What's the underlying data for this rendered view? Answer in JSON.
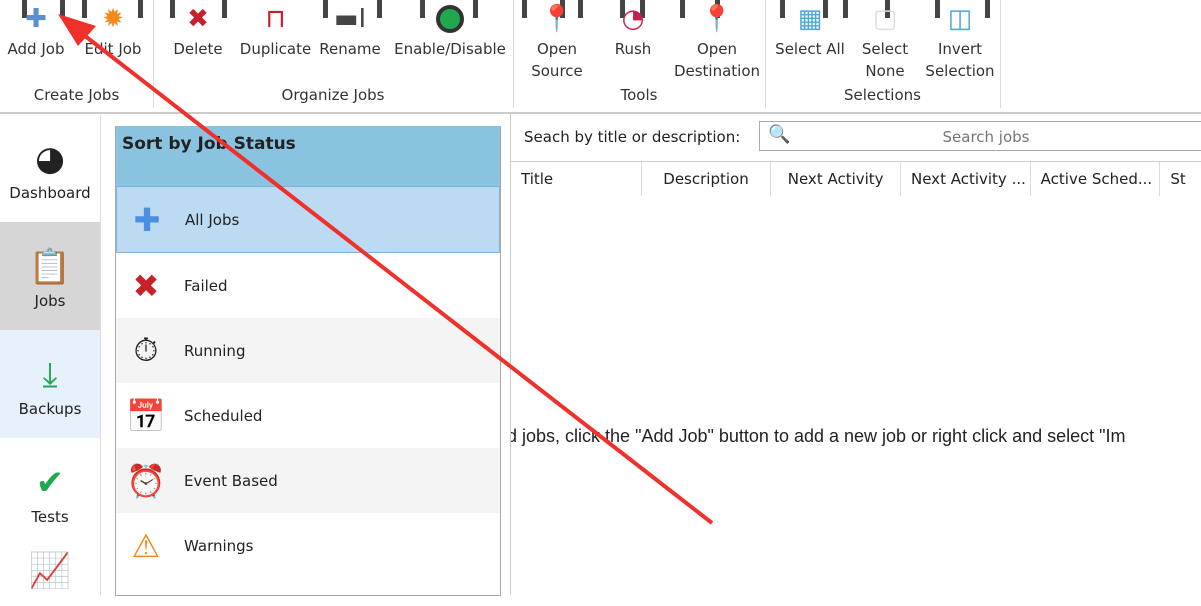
{
  "ribbon": {
    "groups": [
      {
        "label": "Create Jobs"
      },
      {
        "label": "Organize Jobs"
      },
      {
        "label": "Tools"
      },
      {
        "label": "Selections"
      }
    ],
    "buttons": {
      "add_job": "Add Job",
      "edit_job": "Edit Job",
      "delete": "Delete",
      "duplicate": "Duplicate",
      "rename": "Rename",
      "enable_disable": "Enable/Disable",
      "open_source": [
        "Open",
        "Source"
      ],
      "rush": "Rush",
      "open_destination": [
        "Open",
        "Destination"
      ],
      "select_all": "Select All",
      "select_none": [
        "Select",
        "None"
      ],
      "invert_selection": [
        "Invert",
        "Selection"
      ]
    }
  },
  "nav": [
    {
      "label": "Dashboard"
    },
    {
      "label": "Jobs"
    },
    {
      "label": "Backups"
    },
    {
      "label": "Tests"
    }
  ],
  "status_panel": {
    "title": "Sort by Job Status",
    "items": [
      {
        "label": "All Jobs"
      },
      {
        "label": "Failed"
      },
      {
        "label": "Running"
      },
      {
        "label": "Scheduled"
      },
      {
        "label": "Event Based"
      },
      {
        "label": "Warnings"
      }
    ]
  },
  "main": {
    "search_label": "Seach by title or description:",
    "search_placeholder": "Search jobs",
    "columns": [
      "Title",
      "Description",
      "Next Activity",
      "Next Activity ...",
      "Active Sched...",
      "St"
    ],
    "empty_message": "dd jobs, click the \"Add Job\" button to add a new job or right click and select \"Im"
  }
}
